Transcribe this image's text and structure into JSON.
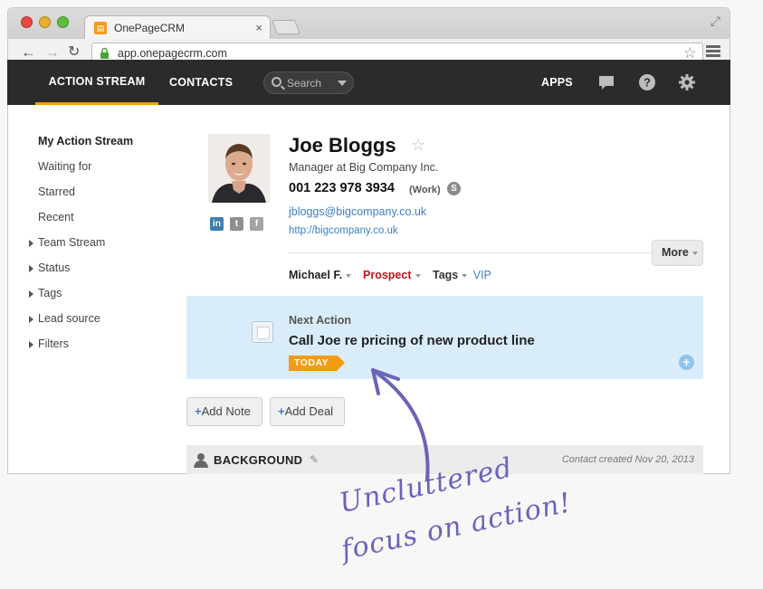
{
  "browser": {
    "tab_title": "OnePageCRM",
    "tab_close": "×",
    "url": "app.onepagecrm.com"
  },
  "topnav": {
    "items": [
      "ACTION STREAM",
      "CONTACTS"
    ],
    "search_placeholder": "Search",
    "apps_label": "APPS",
    "accent_color": "#f3a200"
  },
  "sidebar": {
    "items": [
      {
        "label": "My Action Stream",
        "expandable": false
      },
      {
        "label": "Waiting for",
        "expandable": false
      },
      {
        "label": "Starred",
        "expandable": false
      },
      {
        "label": "Recent",
        "expandable": false
      },
      {
        "label": "Team Stream",
        "expandable": true
      },
      {
        "label": "Status",
        "expandable": true
      },
      {
        "label": "Tags",
        "expandable": true
      },
      {
        "label": "Lead source",
        "expandable": true
      },
      {
        "label": "Filters",
        "expandable": true
      }
    ]
  },
  "contact": {
    "name": "Joe Bloggs",
    "job_title": "Manager at Big Company Inc.",
    "phone": "001 223 978 3934",
    "phone_type": "(Work)",
    "email": "jbloggs@bigcompany.co.uk",
    "website": "http://bigcompany.co.uk",
    "more_label": "More",
    "owner": "Michael F.",
    "status": "Prospect",
    "status_color": "#c0141b",
    "tags_label": "Tags",
    "tag": "VIP"
  },
  "next_action": {
    "label": "Next Action",
    "text": "Call Joe re pricing of new product line",
    "badge": "TODAY",
    "badge_color": "#f39c12",
    "background": "#d9ecf9"
  },
  "buttons": {
    "add_note": "Add Note",
    "add_deal": "Add Deal"
  },
  "background_section": {
    "title": "BACKGROUND",
    "created": "Contact created Nov 20, 2013"
  },
  "annotation": {
    "line1": "Uncluttered",
    "line2": "focus on action!",
    "color": "#6a64b8"
  }
}
